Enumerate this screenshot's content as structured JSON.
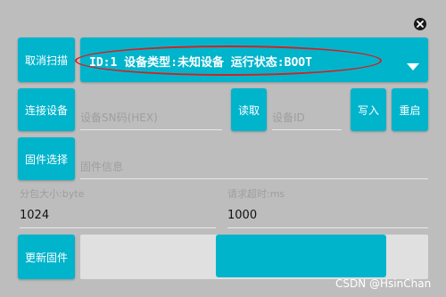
{
  "close_icon": "close-icon",
  "scan": {
    "cancel_label": "取消扫描"
  },
  "device_combo": {
    "selected": "ID:1  设备类型:未知设备  运行状态:BOOT",
    "dropdown_icon": "triangle-down-icon"
  },
  "connection": {
    "connect_label": "连接设备",
    "sn_placeholder": "设备SN码(HEX)",
    "read_label": "读取",
    "device_id_placeholder": "设备ID",
    "write_label": "写入",
    "restart_label": "重启"
  },
  "firmware": {
    "select_label": "固件选择",
    "info_placeholder": "固件信息"
  },
  "packet": {
    "size_label": "分包大小:byte",
    "size_value": "1024",
    "timeout_label": "请求超时:ms",
    "timeout_value": "1000"
  },
  "update": {
    "label": "更新固件",
    "progress_fill_start": 0.39,
    "progress_fill_end": 0.88
  },
  "watermark": "CSDN @HsinChan",
  "colors": {
    "accent": "#00b4cc",
    "background": "#bdbdbd",
    "annotation": "#d61f1f"
  }
}
